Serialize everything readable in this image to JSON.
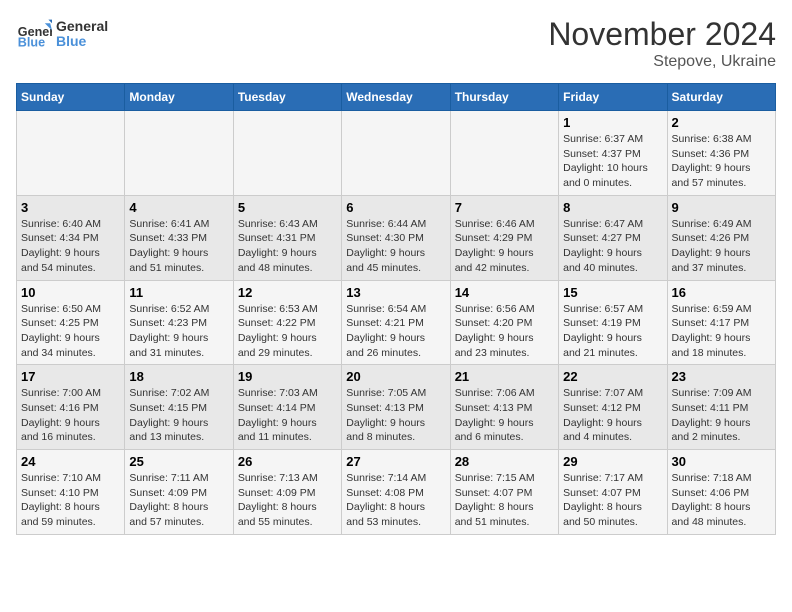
{
  "header": {
    "logo_line1": "General",
    "logo_line2": "Blue",
    "title": "November 2024",
    "subtitle": "Stepove, Ukraine"
  },
  "weekdays": [
    "Sunday",
    "Monday",
    "Tuesday",
    "Wednesday",
    "Thursday",
    "Friday",
    "Saturday"
  ],
  "weeks": [
    [
      {
        "day": "",
        "detail": ""
      },
      {
        "day": "",
        "detail": ""
      },
      {
        "day": "",
        "detail": ""
      },
      {
        "day": "",
        "detail": ""
      },
      {
        "day": "",
        "detail": ""
      },
      {
        "day": "1",
        "detail": "Sunrise: 6:37 AM\nSunset: 4:37 PM\nDaylight: 10 hours\nand 0 minutes."
      },
      {
        "day": "2",
        "detail": "Sunrise: 6:38 AM\nSunset: 4:36 PM\nDaylight: 9 hours\nand 57 minutes."
      }
    ],
    [
      {
        "day": "3",
        "detail": "Sunrise: 6:40 AM\nSunset: 4:34 PM\nDaylight: 9 hours\nand 54 minutes."
      },
      {
        "day": "4",
        "detail": "Sunrise: 6:41 AM\nSunset: 4:33 PM\nDaylight: 9 hours\nand 51 minutes."
      },
      {
        "day": "5",
        "detail": "Sunrise: 6:43 AM\nSunset: 4:31 PM\nDaylight: 9 hours\nand 48 minutes."
      },
      {
        "day": "6",
        "detail": "Sunrise: 6:44 AM\nSunset: 4:30 PM\nDaylight: 9 hours\nand 45 minutes."
      },
      {
        "day": "7",
        "detail": "Sunrise: 6:46 AM\nSunset: 4:29 PM\nDaylight: 9 hours\nand 42 minutes."
      },
      {
        "day": "8",
        "detail": "Sunrise: 6:47 AM\nSunset: 4:27 PM\nDaylight: 9 hours\nand 40 minutes."
      },
      {
        "day": "9",
        "detail": "Sunrise: 6:49 AM\nSunset: 4:26 PM\nDaylight: 9 hours\nand 37 minutes."
      }
    ],
    [
      {
        "day": "10",
        "detail": "Sunrise: 6:50 AM\nSunset: 4:25 PM\nDaylight: 9 hours\nand 34 minutes."
      },
      {
        "day": "11",
        "detail": "Sunrise: 6:52 AM\nSunset: 4:23 PM\nDaylight: 9 hours\nand 31 minutes."
      },
      {
        "day": "12",
        "detail": "Sunrise: 6:53 AM\nSunset: 4:22 PM\nDaylight: 9 hours\nand 29 minutes."
      },
      {
        "day": "13",
        "detail": "Sunrise: 6:54 AM\nSunset: 4:21 PM\nDaylight: 9 hours\nand 26 minutes."
      },
      {
        "day": "14",
        "detail": "Sunrise: 6:56 AM\nSunset: 4:20 PM\nDaylight: 9 hours\nand 23 minutes."
      },
      {
        "day": "15",
        "detail": "Sunrise: 6:57 AM\nSunset: 4:19 PM\nDaylight: 9 hours\nand 21 minutes."
      },
      {
        "day": "16",
        "detail": "Sunrise: 6:59 AM\nSunset: 4:17 PM\nDaylight: 9 hours\nand 18 minutes."
      }
    ],
    [
      {
        "day": "17",
        "detail": "Sunrise: 7:00 AM\nSunset: 4:16 PM\nDaylight: 9 hours\nand 16 minutes."
      },
      {
        "day": "18",
        "detail": "Sunrise: 7:02 AM\nSunset: 4:15 PM\nDaylight: 9 hours\nand 13 minutes."
      },
      {
        "day": "19",
        "detail": "Sunrise: 7:03 AM\nSunset: 4:14 PM\nDaylight: 9 hours\nand 11 minutes."
      },
      {
        "day": "20",
        "detail": "Sunrise: 7:05 AM\nSunset: 4:13 PM\nDaylight: 9 hours\nand 8 minutes."
      },
      {
        "day": "21",
        "detail": "Sunrise: 7:06 AM\nSunset: 4:13 PM\nDaylight: 9 hours\nand 6 minutes."
      },
      {
        "day": "22",
        "detail": "Sunrise: 7:07 AM\nSunset: 4:12 PM\nDaylight: 9 hours\nand 4 minutes."
      },
      {
        "day": "23",
        "detail": "Sunrise: 7:09 AM\nSunset: 4:11 PM\nDaylight: 9 hours\nand 2 minutes."
      }
    ],
    [
      {
        "day": "24",
        "detail": "Sunrise: 7:10 AM\nSunset: 4:10 PM\nDaylight: 8 hours\nand 59 minutes."
      },
      {
        "day": "25",
        "detail": "Sunrise: 7:11 AM\nSunset: 4:09 PM\nDaylight: 8 hours\nand 57 minutes."
      },
      {
        "day": "26",
        "detail": "Sunrise: 7:13 AM\nSunset: 4:09 PM\nDaylight: 8 hours\nand 55 minutes."
      },
      {
        "day": "27",
        "detail": "Sunrise: 7:14 AM\nSunset: 4:08 PM\nDaylight: 8 hours\nand 53 minutes."
      },
      {
        "day": "28",
        "detail": "Sunrise: 7:15 AM\nSunset: 4:07 PM\nDaylight: 8 hours\nand 51 minutes."
      },
      {
        "day": "29",
        "detail": "Sunrise: 7:17 AM\nSunset: 4:07 PM\nDaylight: 8 hours\nand 50 minutes."
      },
      {
        "day": "30",
        "detail": "Sunrise: 7:18 AM\nSunset: 4:06 PM\nDaylight: 8 hours\nand 48 minutes."
      }
    ]
  ]
}
